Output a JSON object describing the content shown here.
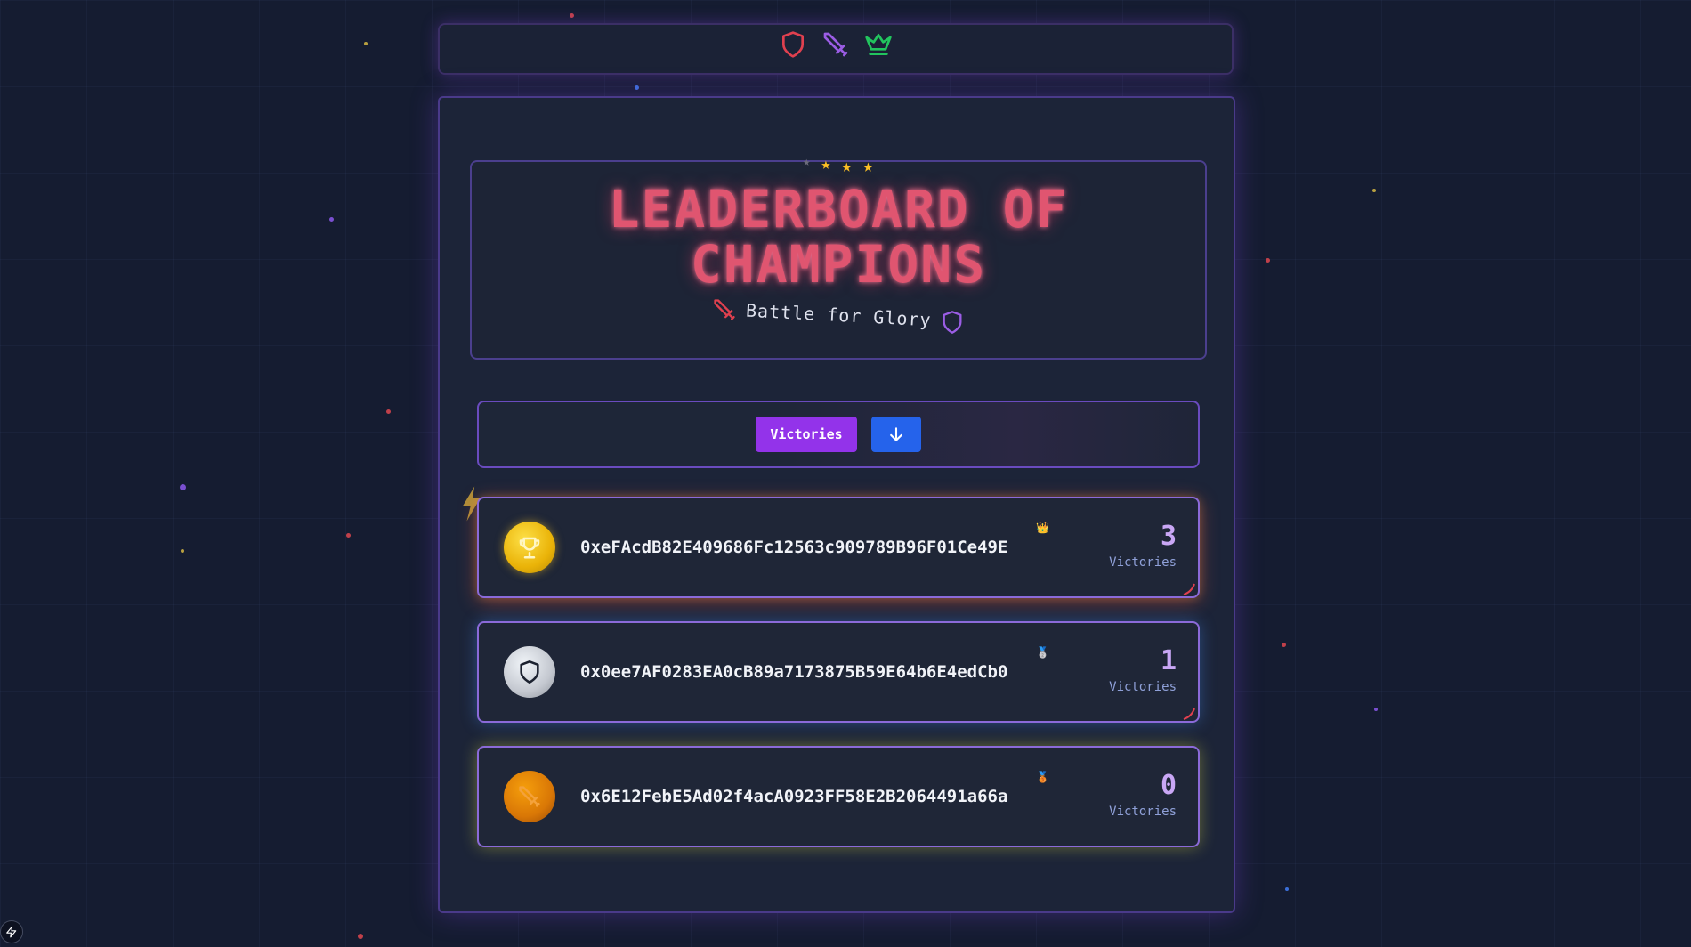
{
  "toolbar": {
    "icons": [
      "shield-icon",
      "sword-icon",
      "crown-icon"
    ]
  },
  "header": {
    "title_line1": "LEADERBOARD OF",
    "title_line2": "CHAMPIONS",
    "subtitle": "Battle for Glory"
  },
  "filters": {
    "sort_label": "Victories",
    "sort_direction_icon": "arrow-down-icon"
  },
  "entries": [
    {
      "address": "0xeFAcdB82E409686Fc12563c909789B96F01Ce49E",
      "score": "3",
      "score_label": "Victories",
      "badge": "👑",
      "medal_icon": "trophy-icon"
    },
    {
      "address": "0x0ee7AF0283EA0cB89a7173875B59E64b6E4edCb0",
      "score": "1",
      "score_label": "Victories",
      "badge": "🥈",
      "medal_icon": "shield-icon"
    },
    {
      "address": "0x6E12FebE5Ad02f4acA0923FF58E2B2064491a66a",
      "score": "0",
      "score_label": "Victories",
      "badge": "🥉",
      "medal_icon": "sword-icon"
    }
  ],
  "colors": {
    "accent_purple": "#9333ea",
    "accent_blue": "#2563eb",
    "title_red": "#e05570",
    "gold": "#eab308",
    "silver": "#c4c8d0",
    "bronze": "#d97706"
  }
}
